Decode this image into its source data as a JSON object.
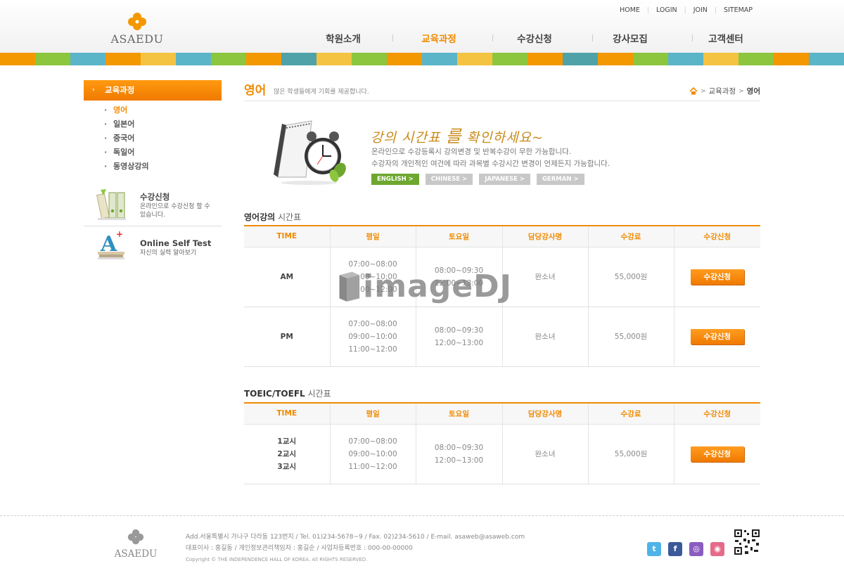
{
  "header": {
    "logo_text": "ASAEDU",
    "util_links": [
      "HOME",
      "LOGIN",
      "JOIN",
      "SITEMAP"
    ],
    "nav": [
      {
        "label": "학원소개",
        "active": false
      },
      {
        "label": "교육과정",
        "active": true
      },
      {
        "label": "수강신청",
        "active": false
      },
      {
        "label": "강사모집",
        "active": false
      },
      {
        "label": "고객센터",
        "active": false
      }
    ]
  },
  "colors": {
    "accent": "#f08a00",
    "green": "#6ea72f",
    "stripe": [
      "#f39800",
      "#8cc63f",
      "#5bb5c8",
      "#f39800",
      "#f5c342",
      "#5bb5c8",
      "#8cc63f",
      "#f39800",
      "#4fa3a8",
      "#f5c342",
      "#8cc63f",
      "#f39800",
      "#5bb5c8",
      "#f5c342",
      "#8cc63f",
      "#f39800",
      "#4fa3a8",
      "#f39800",
      "#8cc63f",
      "#5bb5c8",
      "#f5c342",
      "#8cc63f",
      "#f39800",
      "#5bb5c8"
    ]
  },
  "sidebar": {
    "title": "교육과정",
    "items": [
      {
        "label": "영어",
        "active": true
      },
      {
        "label": "일본어",
        "active": false
      },
      {
        "label": "중국어",
        "active": false
      },
      {
        "label": "독일어",
        "active": false
      },
      {
        "label": "동영상강의",
        "active": false
      }
    ],
    "box1": {
      "title": "수강신청",
      "desc": "온라인으로 수강신청 할 수 있습니다.",
      "icon": "books-icon"
    },
    "box2": {
      "title": "Online Self Test",
      "desc": "자신의 실력 알아보기",
      "icon": "test-a-icon"
    }
  },
  "content": {
    "title": "영어",
    "subtitle": "많은 학생들에게 기회를 제공합니다.",
    "breadcrumb": [
      "교육과정",
      "영어"
    ],
    "banner": {
      "headline_part1": "강의 시간표",
      "headline_big": "를",
      "headline_part2": "확인하세요~",
      "desc1": "온라인으로 수강등록시 강의변경 및 반복수강이 무한 가능합니다.",
      "desc2": "수강자의 개인적인 여건에 따라 과목별 수강시간 변경이 언제든지 가능합니다.",
      "langs": [
        {
          "label": "ENGLISH >",
          "active": true
        },
        {
          "label": "CHINESE >",
          "active": false
        },
        {
          "label": "JAPANESE >",
          "active": false
        },
        {
          "label": "GERMAN >",
          "active": false
        }
      ]
    },
    "section1_title_bold": "영어강의",
    "section1_title_rest": " 시간표",
    "section2_title_bold": "TOEIC/TOEFL",
    "section2_title_rest": " 시간표",
    "table_headers": [
      "TIME",
      "평일",
      "토요일",
      "담당강사명",
      "수강료",
      "수강신청"
    ],
    "table1_rows": [
      {
        "time": "AM",
        "weekday": [
          "07:00~08:00",
          "09:00~10:00",
          "11:00~12:00"
        ],
        "saturday": [
          "08:00~09:30",
          "12:00~13:00"
        ],
        "teacher": "완소녀",
        "fee": "55,000원",
        "button": "수강신청"
      },
      {
        "time": "PM",
        "weekday": [
          "07:00~08:00",
          "09:00~10:00",
          "11:00~12:00"
        ],
        "saturday": [
          "08:00~09:30",
          "12:00~13:00"
        ],
        "teacher": "완소녀",
        "fee": "55,000원",
        "button": "수강신청"
      }
    ],
    "table2_rows": [
      {
        "time": [
          "1교시",
          "2교시",
          "3교시"
        ],
        "weekday": [
          "07:00~08:00",
          "09:00~10:00",
          "11:00~12:00"
        ],
        "saturday": [
          "08:00~09:30",
          "12:00~13:00"
        ],
        "teacher": "완소녀",
        "fee": "55,000원",
        "button": "수강신청"
      }
    ],
    "watermark": "imageDJ"
  },
  "footer": {
    "logo_text": "ASAEDU",
    "line1": "Add.서울특별시 가나구 다라동 123번지  / Tel. 01)234-5678~9  / Fax. 02)234-5610  / E-mail. asaweb@asaweb.com",
    "line2": "대표이사 : 홍길동  / 개인정보관리책임자 : 홍길순  / 사업자등록번호 : 000-00-00000",
    "copyright": "Copyright © THE INDEPENDENCE HALL OF KOREA. All RIGHTS RESERVED.",
    "sns": [
      {
        "name": "twitter-icon",
        "glyph": "t",
        "color": "#4fb3e8"
      },
      {
        "name": "facebook-icon",
        "glyph": "f",
        "color": "#3b5a9a"
      },
      {
        "name": "me2day-icon",
        "glyph": "◎",
        "color": "#8a5cc0"
      },
      {
        "name": "blog-icon",
        "glyph": "◉",
        "color": "#e66a8a"
      }
    ]
  }
}
